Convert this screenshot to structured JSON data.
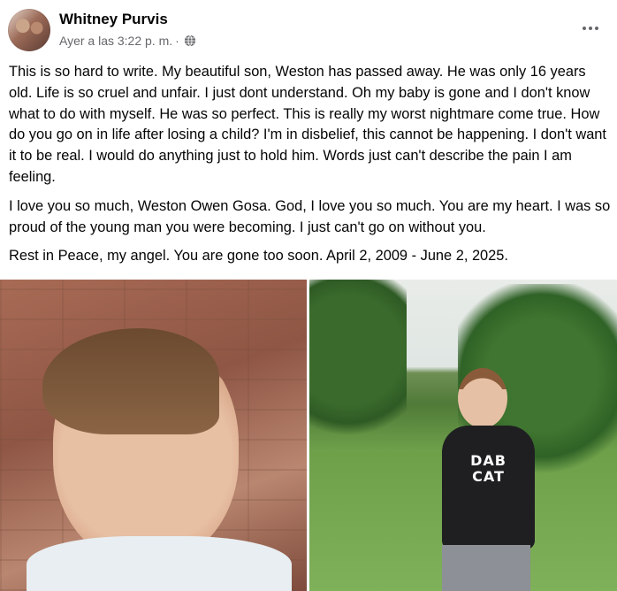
{
  "post": {
    "author": "Whitney Purvis",
    "timestamp": "Ayer a las 3:22 p. m.",
    "separator": "·",
    "paragraphs": [
      "This is so hard to write. My beautiful son, Weston has passed away.  He was only 16 years old. Life is so cruel and unfair. I just dont understand. Oh my baby is gone and I don't know what to do with myself. He was so perfect. This is really my worst nightmare come true. How do you go on in life after losing a child?  I'm in disbelief, this cannot be happening. I don't want it to be real.  I would do anything just to hold him. Words just can't describe the pain I am feeling.",
      "I love you so much, Weston Owen Gosa.  God, I love you so much.  You are my heart.  I was so proud of the young man you were becoming. I just can't go on without you.",
      "Rest in Peace, my angel.  You are gone too soon.  April 2, 2009 - June 2, 2025."
    ]
  },
  "photos": {
    "right_shirt_text": "DAB\nCAT"
  },
  "icons": {
    "globe": "globe-icon",
    "more": "more-options-icon"
  },
  "colors": {
    "text": "#050505",
    "secondary_text": "#65676b"
  }
}
